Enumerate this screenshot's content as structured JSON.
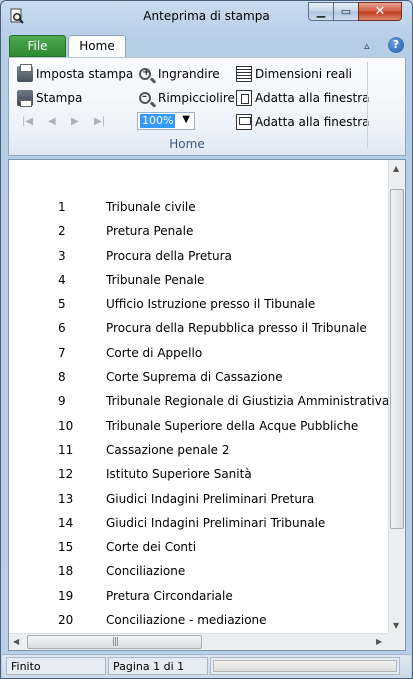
{
  "window": {
    "title": "Anteprima di stampa"
  },
  "tabs": {
    "file": "File",
    "home": "Home"
  },
  "ribbon": {
    "page_setup": "Imposta stampa",
    "print": "Stampa",
    "zoom_in": "Ingrandire",
    "zoom_out": "Rimpicciolire",
    "actual_size": "Dimensioni reali",
    "fit_window_1": "Adatta alla finestra",
    "fit_window_2": "Adatta alla finestra",
    "zoom_value": "100%",
    "group_label": "Home"
  },
  "preview": {
    "rows": [
      {
        "num": "1",
        "label": "Tribunale civile"
      },
      {
        "num": "2",
        "label": "Pretura Penale"
      },
      {
        "num": "3",
        "label": "Procura della Pretura"
      },
      {
        "num": "4",
        "label": "Tribunale Penale"
      },
      {
        "num": "5",
        "label": "Ufficio Istruzione presso il Tibunale"
      },
      {
        "num": "6",
        "label": "Procura della Repubblica presso il Tribunale"
      },
      {
        "num": "7",
        "label": "Corte di Appello"
      },
      {
        "num": "8",
        "label": "Corte Suprema di Cassazione"
      },
      {
        "num": "9",
        "label": "Tribunale Regionale di Giustizia Amministrativa"
      },
      {
        "num": "10",
        "label": "Tribunale Superiore della Acque Pubbliche"
      },
      {
        "num": "11",
        "label": "Cassazione penale 2"
      },
      {
        "num": "12",
        "label": "Istituto Superiore Sanità"
      },
      {
        "num": "13",
        "label": "Giudici Indagini Preliminari Pretura"
      },
      {
        "num": "14",
        "label": "Giudici Indagini Preliminari Tribunale"
      },
      {
        "num": "15",
        "label": "Corte dei Conti"
      },
      {
        "num": "18",
        "label": "Conciliazione"
      },
      {
        "num": "19",
        "label": "Pretura Circondariale"
      },
      {
        "num": "20",
        "label": "Conciliazione - mediazione"
      }
    ]
  },
  "statusbar": {
    "state": "Finito",
    "page": "Pagina 1 di 1"
  },
  "icons": {
    "app": "print-preview-icon",
    "page_setup": "page-setup-icon",
    "print": "printer-icon",
    "zoom_in": "zoom-in-icon",
    "zoom_out": "zoom-out-icon",
    "actual_size": "actual-size-icon",
    "fit": "fit-window-icon",
    "help": "help-icon"
  }
}
